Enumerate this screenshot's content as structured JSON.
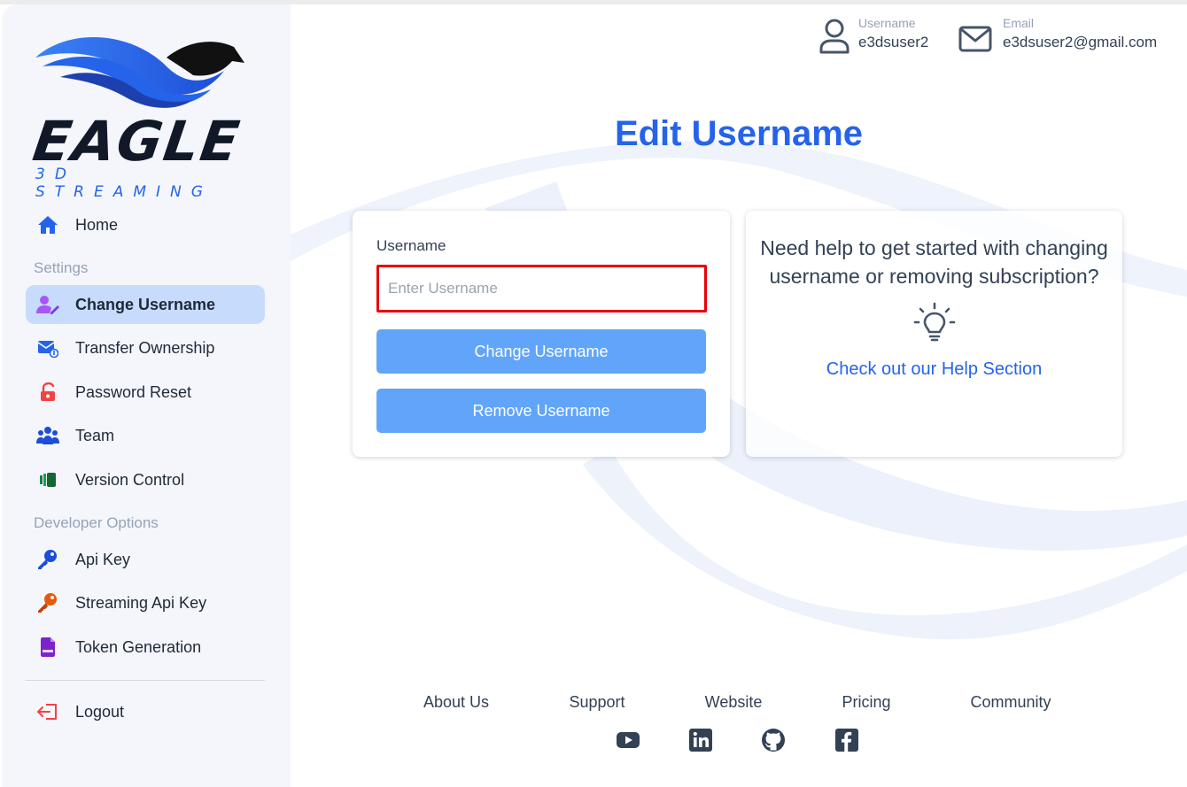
{
  "brand": {
    "name": "EAGLE",
    "tagline": "3D STREAMING"
  },
  "sidebar": {
    "home": "Home",
    "settings_label": "Settings",
    "settings_items": [
      {
        "label": "Change Username",
        "icon": "user-edit-icon",
        "active": true
      },
      {
        "label": "Transfer Ownership",
        "icon": "mail-transfer-icon"
      },
      {
        "label": "Password Reset",
        "icon": "unlock-icon"
      },
      {
        "label": "Team",
        "icon": "team-icon"
      },
      {
        "label": "Version Control",
        "icon": "version-icon"
      }
    ],
    "developer_label": "Developer Options",
    "developer_items": [
      {
        "label": "Api Key",
        "icon": "key-icon"
      },
      {
        "label": "Streaming Api Key",
        "icon": "key-icon"
      },
      {
        "label": "Token Generation",
        "icon": "json-file-icon"
      }
    ],
    "logout": "Logout"
  },
  "header": {
    "username_label": "Username",
    "username_value": "e3dsuser2",
    "email_label": "Email",
    "email_value": "e3dsuser2@gmail.com"
  },
  "main": {
    "title": "Edit Username",
    "form": {
      "field_label": "Username",
      "placeholder": "Enter Username",
      "value": "",
      "change_button": "Change Username",
      "remove_button": "Remove Username"
    },
    "help": {
      "text": "Need help to get started with changing username or removing subscription?",
      "link": "Check out our Help Section"
    }
  },
  "footer": {
    "links": [
      "About Us",
      "Support",
      "Website",
      "Pricing",
      "Community"
    ],
    "social": [
      "youtube-icon",
      "linkedin-icon",
      "github-icon",
      "facebook-icon"
    ]
  },
  "colors": {
    "accent": "#2563eb",
    "button": "#60a5fa",
    "active_nav": "#c7dcfd",
    "input_border": "#e8000a",
    "sidebar_bg": "#f4f6fb"
  }
}
